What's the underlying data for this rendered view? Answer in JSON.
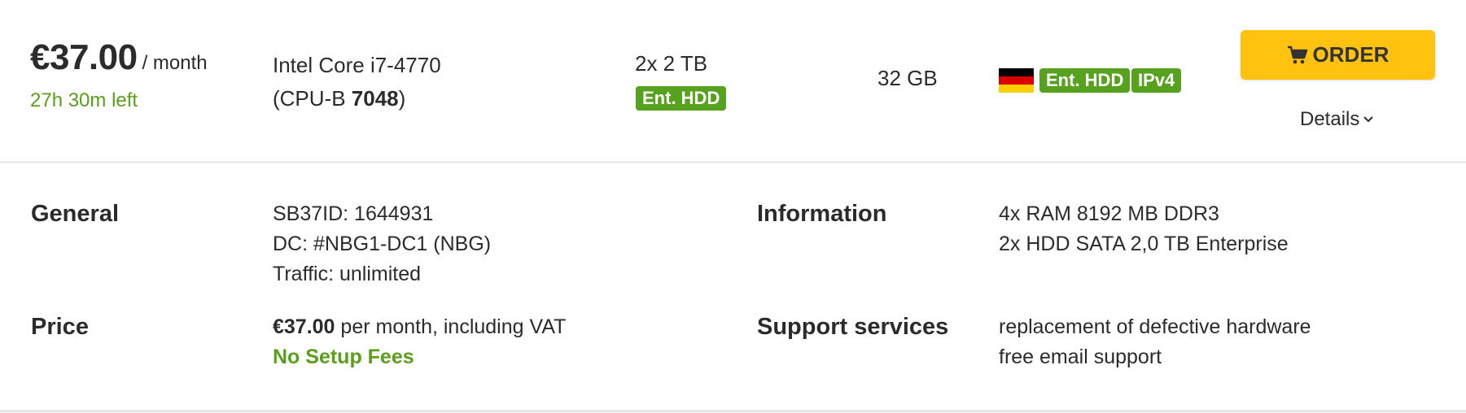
{
  "offer": {
    "price_amount": "€37.00",
    "price_period": "/ month",
    "time_left": "27h 30m left",
    "cpu_model": "Intel Core i7-4770",
    "cpu_bench_prefix": "(CPU-B ",
    "cpu_bench_score": "7048",
    "cpu_bench_suffix": ")",
    "storage": "2x 2 TB",
    "storage_badge": "Ent. HDD",
    "ram": "32 GB",
    "location_flag": "germany-flag-icon",
    "feature_badges": [
      "Ent. HDD",
      "IPv4"
    ],
    "order_label": "ORDER",
    "order_icon": "shopping-cart-icon",
    "details_label": "Details",
    "details_icon": "chevron-down-icon"
  },
  "details": {
    "general_label": "General",
    "general_lines": [
      "SB37ID: 1644931",
      "DC: #NBG1-DC1 (NBG)",
      "Traffic: unlimited"
    ],
    "information_label": "Information",
    "information_lines": [
      "4x RAM 8192 MB DDR3",
      "2x HDD SATA 2,0 TB Enterprise"
    ],
    "price_label": "Price",
    "price_amount": "€37.00",
    "price_suffix": " per month, including VAT",
    "setup_fees": "No Setup Fees",
    "support_label": "Support services",
    "support_lines": [
      "replacement of defective hardware",
      "free email support"
    ]
  },
  "colors": {
    "accent_green": "#56a11d",
    "order_yellow": "#ffc20e",
    "text": "#2b2b2b",
    "flag_black": "#000000",
    "flag_red": "#dd0000",
    "flag_gold": "#ffce00"
  }
}
